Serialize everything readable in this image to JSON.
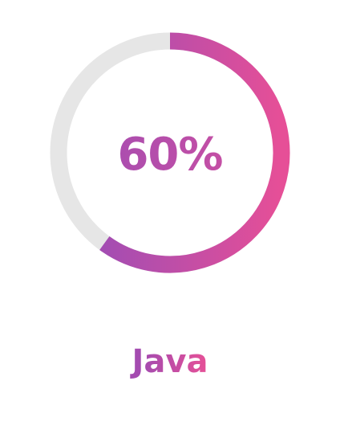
{
  "skill": {
    "name": "Java",
    "percent_label": "60%",
    "progress": 0.6
  },
  "colors": {
    "track": "#e6e6e6",
    "gradient_start": "#a44db2",
    "gradient_end": "#e64f97"
  }
}
